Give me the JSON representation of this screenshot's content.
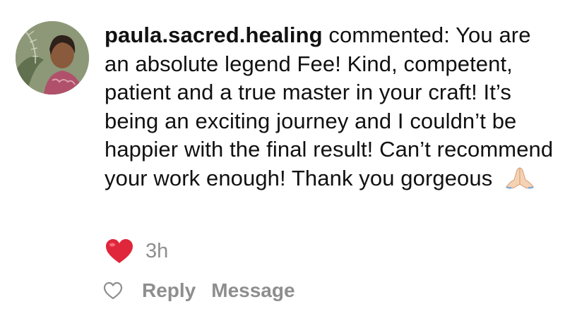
{
  "comment": {
    "username": "paula.sacred.healing",
    "action": "commented:",
    "text": "You are an absolute legend Fee! Kind, competent, patient and a true master in your craft! It’s being an exciting journey and I couldn’t be happier with the final result! Can’t recommend your work enough! Thank you gorgeous",
    "trailing_emoji": "folded-hands-emoji",
    "reaction": "red-heart-emoji",
    "timestamp": "3h"
  },
  "actions": {
    "like_icon": "heart-outline-icon",
    "reply_label": "Reply",
    "message_label": "Message"
  },
  "colors": {
    "text": "#111111",
    "secondary": "#8e8e8e",
    "heart_red": "#e0263a",
    "background": "#ffffff"
  }
}
